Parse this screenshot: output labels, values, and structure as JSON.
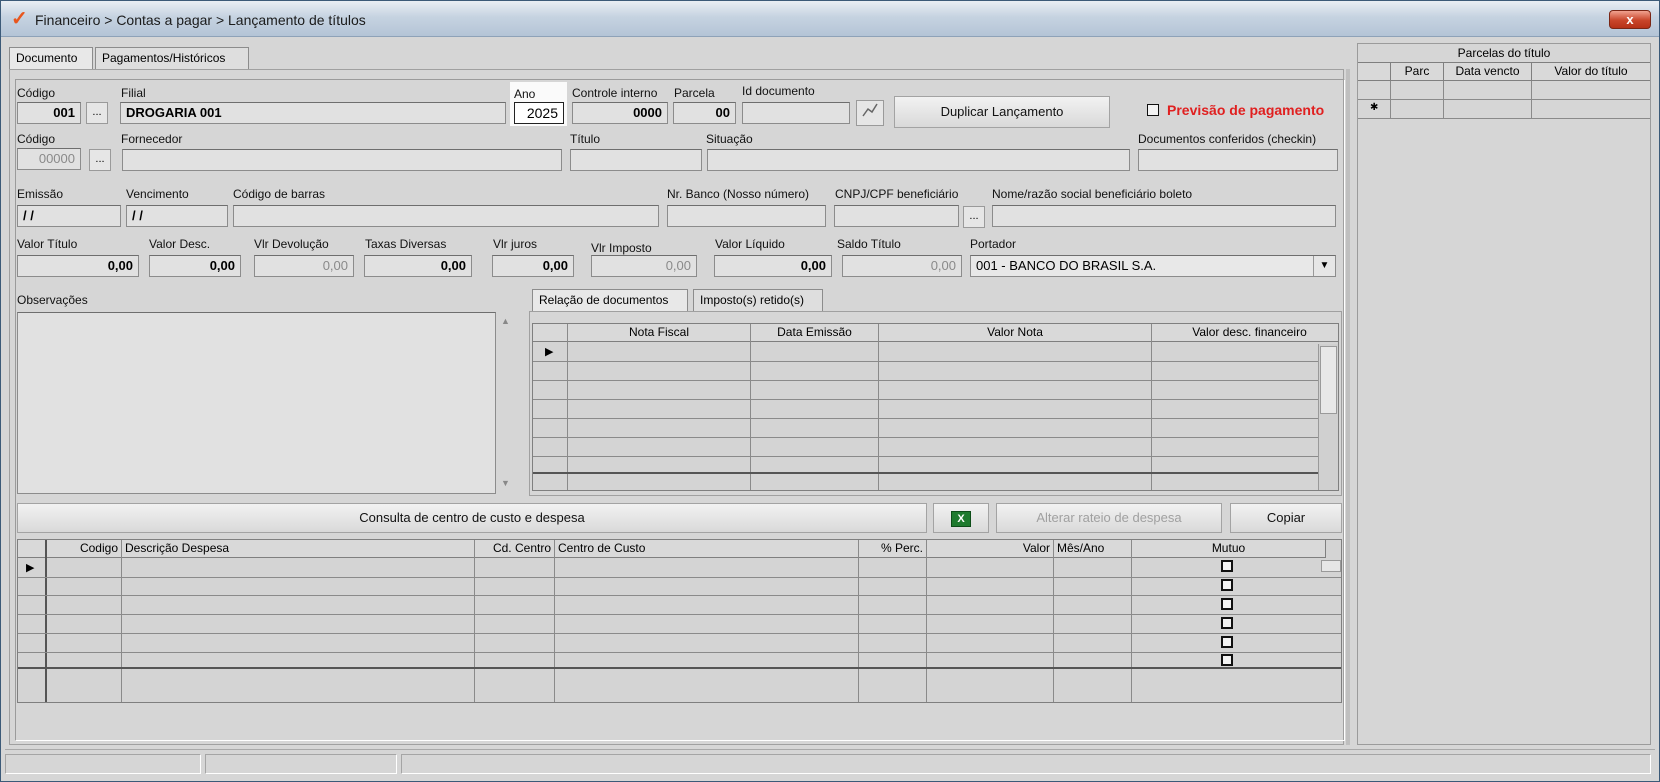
{
  "window": {
    "title": "Financeiro > Contas a pagar > Lançamento de títulos",
    "close": "x"
  },
  "tabs": [
    {
      "label": "Documento"
    },
    {
      "label": "Pagamentos/Históricos"
    }
  ],
  "fields": {
    "codigo_filial": {
      "label": "Código",
      "value": "001"
    },
    "filial": {
      "label": "Filial",
      "value": "DROGARIA 001"
    },
    "ano": {
      "label": "Ano",
      "value": "2025"
    },
    "controle_interno": {
      "label": "Controle interno",
      "value": "0000"
    },
    "parcela": {
      "label": "Parcela",
      "value": "00"
    },
    "id_documento": {
      "label": "Id documento",
      "value": ""
    },
    "codigo_fornecedor": {
      "label": "Código",
      "value": "00000"
    },
    "fornecedor": {
      "label": "Fornecedor",
      "value": ""
    },
    "titulo": {
      "label": "Título",
      "value": ""
    },
    "situacao": {
      "label": "Situação",
      "value": ""
    },
    "docs_conferidos": {
      "label": "Documentos conferidos (checkin)",
      "value": ""
    },
    "emissao": {
      "label": "Emissão",
      "value": "/ /"
    },
    "vencimento": {
      "label": "Vencimento",
      "value": "/ /"
    },
    "codigo_barras": {
      "label": "Código de barras",
      "value": ""
    },
    "nr_banco": {
      "label": "Nr. Banco (Nosso número)",
      "value": ""
    },
    "cnpj": {
      "label": "CNPJ/CPF beneficiário",
      "value": ""
    },
    "nome_beneficiario": {
      "label": "Nome/razão social beneficiário boleto",
      "value": ""
    },
    "valor_titulo": {
      "label": "Valor Título",
      "value": "0,00"
    },
    "valor_desc": {
      "label": "Valor Desc.",
      "value": "0,00"
    },
    "vlr_devolucao": {
      "label": "Vlr Devolução",
      "value": "0,00"
    },
    "taxas_diversas": {
      "label": "Taxas Diversas",
      "value": "0,00"
    },
    "vlr_juros": {
      "label": "Vlr juros",
      "value": "0,00"
    },
    "vlr_imposto": {
      "label": "Vlr Imposto",
      "value": "0,00"
    },
    "valor_liquido": {
      "label": "Valor Líquido",
      "value": "0,00"
    },
    "saldo_titulo": {
      "label": "Saldo Título",
      "value": "0,00"
    },
    "portador": {
      "label": "Portador",
      "value": "001 - BANCO DO BRASIL S.A."
    },
    "observacoes": {
      "label": "Observações",
      "value": ""
    }
  },
  "buttons": {
    "duplicar": "Duplicar Lançamento",
    "previsao": "Previsão de pagamento",
    "consulta": "Consulta de centro de custo e despesa",
    "alterar_rateio": "Alterar rateio de despesa",
    "copiar": "Copiar",
    "ellipsis": "..."
  },
  "doc_tabs": [
    {
      "label": "Relação de documentos"
    },
    {
      "label": "Imposto(s) retido(s)"
    }
  ],
  "doc_grid": {
    "columns": [
      "Nota Fiscal",
      "Data Emissão",
      "Valor Nota",
      "Valor desc. financeiro"
    ]
  },
  "despesa_grid": {
    "columns": [
      "Codigo",
      "Descrição Despesa",
      "Cd. Centro",
      "Centro de Custo",
      "% Perc.",
      "Valor",
      "Mês/Ano",
      "Mutuo"
    ]
  },
  "parcelas": {
    "title": "Parcelas do título",
    "columns": [
      "Parc",
      "Data vencto",
      "Valor do título"
    ]
  },
  "colors": {
    "previsao": "#e02020",
    "excel": "#1e7a2e"
  },
  "icons": {
    "app": "check-logo-icon",
    "excel": "excel-icon",
    "dropdown": "chevron-down-icon"
  }
}
